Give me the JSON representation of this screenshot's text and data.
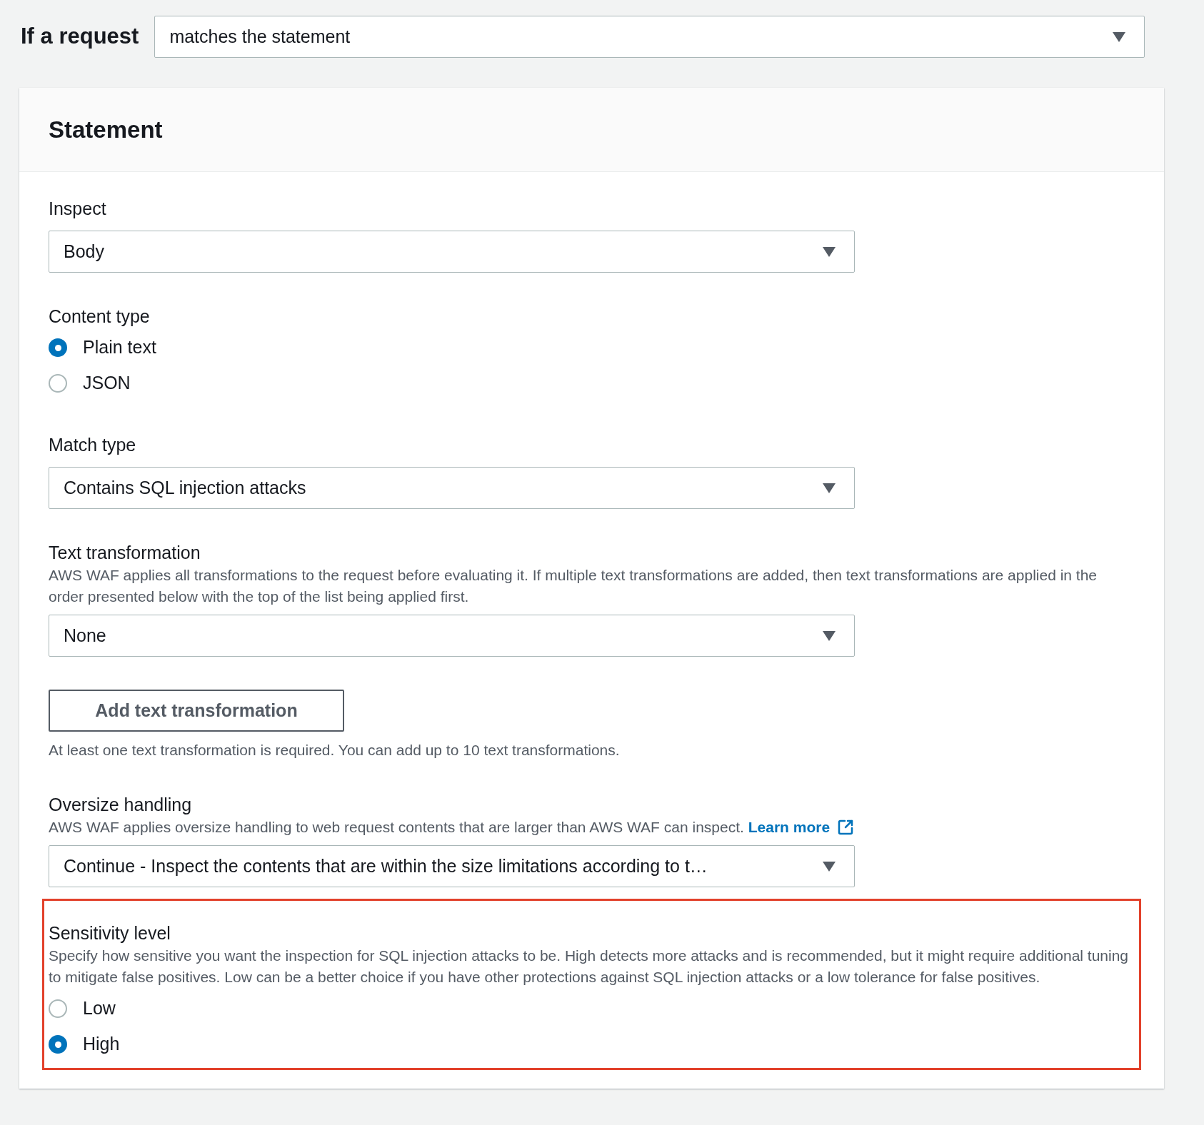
{
  "request_condition": {
    "label": "If a request",
    "value": "matches the statement"
  },
  "statement": {
    "title": "Statement",
    "fields": [
      {
        "kind": "select",
        "label": "Inspect",
        "value": "Body"
      },
      {
        "kind": "radio",
        "label": "Content type",
        "options": [
          {
            "label": "Plain text",
            "selected": true
          },
          {
            "label": "JSON",
            "selected": false
          }
        ]
      },
      {
        "kind": "select",
        "label": "Match type",
        "value": "Contains SQL injection attacks"
      },
      {
        "kind": "select",
        "label": "Text transformation",
        "description": "AWS WAF applies all transformations to the request before evaluating it. If multiple text transformations are added, then text transformations are applied in the order presented below with the top of the list being applied first.",
        "value": "None"
      },
      {
        "kind": "button",
        "label": "Add text transformation",
        "help": "At least one text transformation is required. You can add up to 10 text transformations."
      },
      {
        "kind": "select",
        "label": "Oversize handling",
        "description": "AWS WAF applies oversize handling to web request contents that are larger than AWS WAF can inspect.",
        "link": "Learn more",
        "value": "Continue - Inspect the contents that are within the size limitations according to t…"
      },
      {
        "kind": "radio",
        "label": "Sensitivity level",
        "highlighted": true,
        "description": "Specify how sensitive you want the inspection for SQL injection attacks to be. High detects more attacks and is recommended, but it might require additional tuning to mitigate false positives. Low can be a better choice if you have other protections against SQL injection attacks or a low tolerance for false positives.",
        "options": [
          {
            "label": "Low",
            "selected": false
          },
          {
            "label": "High",
            "selected": true
          }
        ]
      }
    ]
  }
}
